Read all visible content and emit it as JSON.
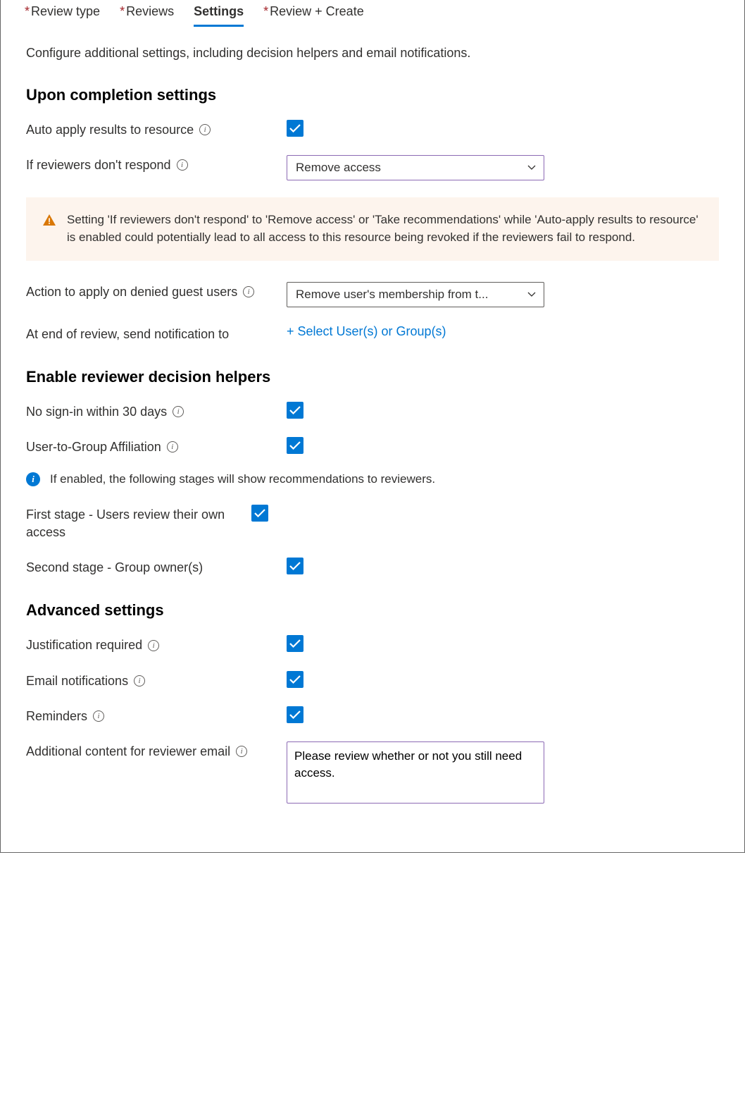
{
  "tabs": [
    {
      "label": "Review type",
      "required": true,
      "active": false
    },
    {
      "label": "Reviews",
      "required": true,
      "active": false
    },
    {
      "label": "Settings",
      "required": false,
      "active": true
    },
    {
      "label": "Review + Create",
      "required": true,
      "active": false
    }
  ],
  "description": "Configure additional settings, including decision helpers and email notifications.",
  "sections": {
    "completion": {
      "heading": "Upon completion settings",
      "auto_apply": {
        "label": "Auto apply results to resource",
        "checked": true
      },
      "no_respond": {
        "label": "If reviewers don't respond",
        "value": "Remove access"
      },
      "warning": "Setting 'If reviewers don't respond' to 'Remove access' or 'Take recommendations' while 'Auto-apply results to resource' is enabled could potentially lead to all access to this resource being revoked if the reviewers fail to respond.",
      "denied_guest": {
        "label": "Action to apply on denied guest users",
        "value": "Remove user's membership from t..."
      },
      "notify": {
        "label": "At end of review, send notification to",
        "link": "+ Select User(s) or Group(s)"
      }
    },
    "helpers": {
      "heading": "Enable reviewer decision helpers",
      "no_signin": {
        "label": "No sign-in within 30 days",
        "checked": true
      },
      "affiliation": {
        "label": "User-to-Group Affiliation",
        "checked": true
      },
      "info": "If enabled, the following stages will show recommendations to reviewers.",
      "stage1": {
        "label": "First stage - Users review their own access",
        "checked": true
      },
      "stage2": {
        "label": "Second stage - Group owner(s)",
        "checked": true
      }
    },
    "advanced": {
      "heading": "Advanced settings",
      "justification": {
        "label": "Justification required",
        "checked": true
      },
      "email": {
        "label": "Email notifications",
        "checked": true
      },
      "reminders": {
        "label": "Reminders",
        "checked": true
      },
      "extra_content": {
        "label": "Additional content for reviewer email",
        "value": "Please review whether or not you still need access."
      }
    }
  }
}
